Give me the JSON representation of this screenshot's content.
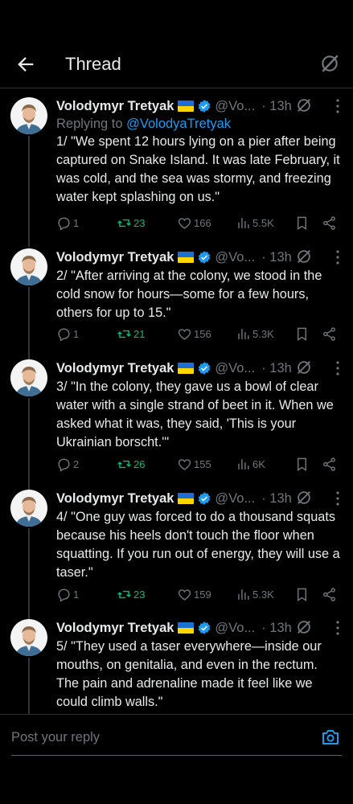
{
  "header": {
    "title": "Thread"
  },
  "reply_bar": {
    "placeholder": "Post your reply"
  },
  "tweets": [
    {
      "name": "Volodymyr Tretyak",
      "handle": "@Vo...",
      "time": "· 13h",
      "replying_prefix": "Replying to ",
      "replying_handle": "@VolodyaTretyak",
      "text": "1/ \"We spent 12 hours lying on a pier after being captured on Snake Island. It was late February, it was cold, and the sea was stormy, and freezing water kept splashing on us.\"",
      "replies": "1",
      "reposts": "23",
      "likes": "166",
      "views": "5.5K"
    },
    {
      "name": "Volodymyr Tretyak",
      "handle": "@Vo...",
      "time": "· 13h",
      "text": "2/ \"After arriving at the colony, we stood in the cold snow for hours—some for a few hours, others for up to 15.\"",
      "replies": "1",
      "reposts": "21",
      "likes": "156",
      "views": "5.3K"
    },
    {
      "name": "Volodymyr Tretyak",
      "handle": "@Vo...",
      "time": "· 13h",
      "text": "3/ \"In the colony, they gave us a bowl of clear water with a single strand of beet in it. When we asked what it was, they said, 'This is your Ukrainian borscht.'\"",
      "replies": "2",
      "reposts": "26",
      "likes": "155",
      "views": "6K"
    },
    {
      "name": "Volodymyr Tretyak",
      "handle": "@Vo...",
      "time": "· 13h",
      "text": "4/ \"One guy was forced to do a thousand squats because his heels don't touch the floor when squatting. If you run out of energy, they will use a taser.\"",
      "replies": "1",
      "reposts": "23",
      "likes": "159",
      "views": "5.3K"
    },
    {
      "name": "Volodymyr Tretyak",
      "handle": "@Vo...",
      "time": "· 13h",
      "text": "5/ \"They used a taser everywhere—inside our mouths, on genitalia, and even in the rectum. The pain and adrenaline made it feel like we could climb walls.\""
    }
  ]
}
